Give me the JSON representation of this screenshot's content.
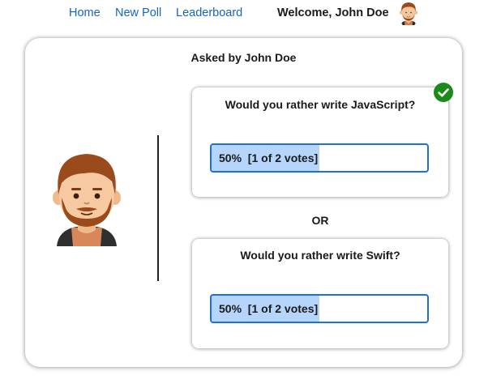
{
  "nav": {
    "links": [
      {
        "label": "Home"
      },
      {
        "label": "New Poll"
      },
      {
        "label": "Leaderboard"
      }
    ],
    "welcome_text": "Welcome, John Doe",
    "avatar_icon": "male-avatar-icon"
  },
  "poll": {
    "asked_by": "Asked by John Doe",
    "author_avatar_icon": "male-avatar-icon",
    "separator": "OR",
    "options": [
      {
        "text": "Would you rather write JavaScript?",
        "result_label": "50%  [1 of 2 votes]",
        "percent": 50,
        "selected": true,
        "selected_icon": "checkmark-icon"
      },
      {
        "text": "Would you rather write Swift?",
        "result_label": "50%  [1 of 2 votes]",
        "percent": 50,
        "selected": false
      }
    ]
  },
  "colors": {
    "link": "#1565c0",
    "bar_border": "#1e6fd9",
    "bar_fill": "#b6d5fb",
    "check_badge": "#1a8a1a"
  }
}
